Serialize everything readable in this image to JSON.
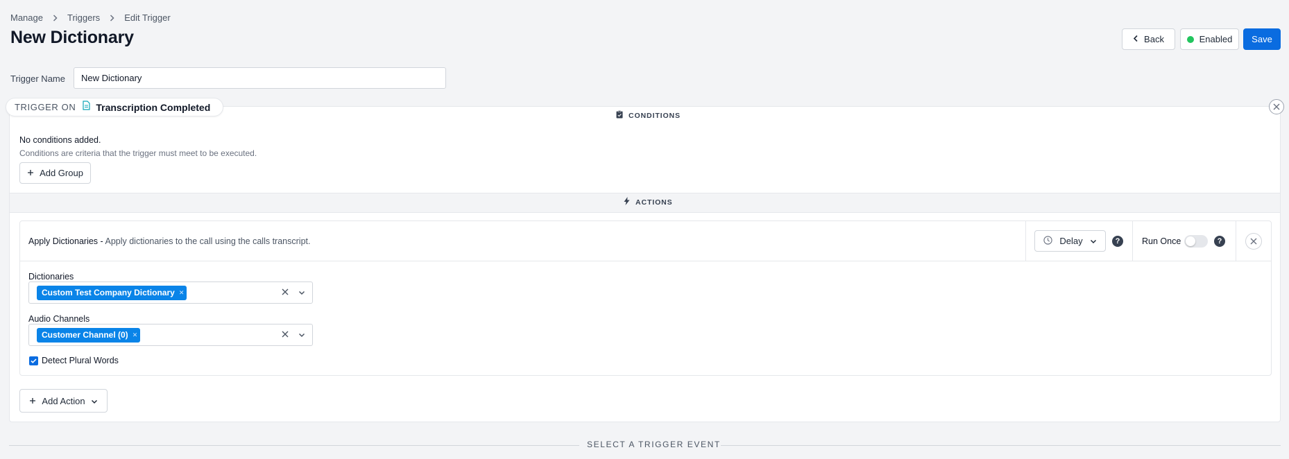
{
  "breadcrumb": {
    "items": [
      "Manage",
      "Triggers",
      "Edit Trigger"
    ]
  },
  "page": {
    "title": "New Dictionary"
  },
  "header": {
    "back_label": "Back",
    "enabled_label": "Enabled",
    "save_label": "Save",
    "enabled_color": "#22c55e"
  },
  "form": {
    "trigger_name_label": "Trigger Name",
    "trigger_name_value": "New Dictionary"
  },
  "trigger": {
    "on_label": "TRIGGER ON",
    "event": "Transcription Completed"
  },
  "conditions": {
    "header": "CONDITIONS",
    "empty_title": "No conditions added.",
    "empty_desc": "Conditions are criteria that the trigger must meet to be executed.",
    "add_group_label": "Add Group"
  },
  "actions": {
    "header": "ACTIONS",
    "item": {
      "title": "Apply Dictionaries -",
      "desc": "Apply dictionaries to the call using the calls transcript.",
      "delay_label": "Delay",
      "run_once_label": "Run Once",
      "run_once_enabled": false,
      "dictionaries_label": "Dictionaries",
      "dictionaries_selected": "Custom Test Company Dictionary",
      "audio_label": "Audio Channels",
      "audio_selected": "Customer Channel (0)",
      "plural_label": "Detect Plural Words",
      "plural_checked": true
    },
    "add_action_label": "Add Action"
  },
  "footer": {
    "select_event_label": "SELECT A TRIGGER EVENT"
  },
  "colors": {
    "primary": "#0a6ce0",
    "chip": "#0a84e8"
  }
}
